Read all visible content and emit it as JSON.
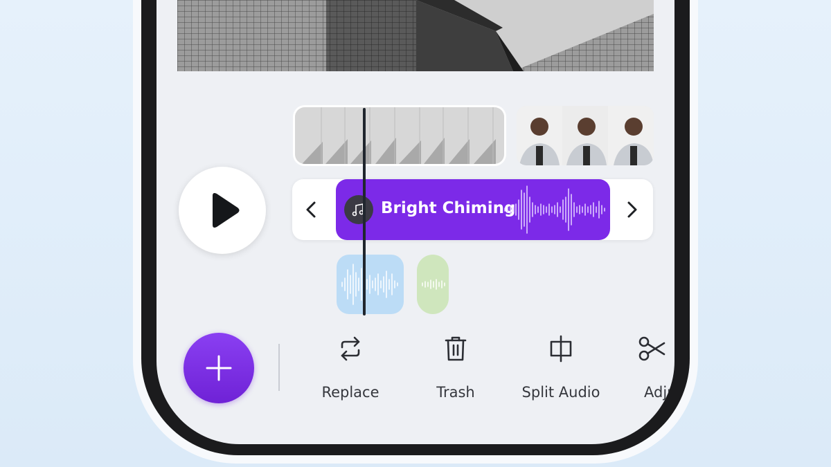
{
  "audio_track": {
    "clip_title": "Bright Chiming",
    "clip_color": "#7c2ae8"
  },
  "icons": {
    "play": "play-icon",
    "prev": "chevron-left-icon",
    "next": "chevron-right-icon",
    "music": "music-note-icon",
    "add": "plus-icon"
  },
  "toolbar": {
    "tools": [
      {
        "label": "Replace",
        "icon": "replace-icon"
      },
      {
        "label": "Trash",
        "icon": "trash-icon"
      },
      {
        "label": "Split Audio",
        "icon": "split-audio-icon"
      },
      {
        "label": "Adju",
        "icon": "scissors-icon"
      }
    ]
  },
  "colors": {
    "accent": "#7c2ae8",
    "secondary_audio_1": "#bcdcf6",
    "secondary_audio_2": "#cfe6bd",
    "screen_bg": "#eef0f4"
  }
}
